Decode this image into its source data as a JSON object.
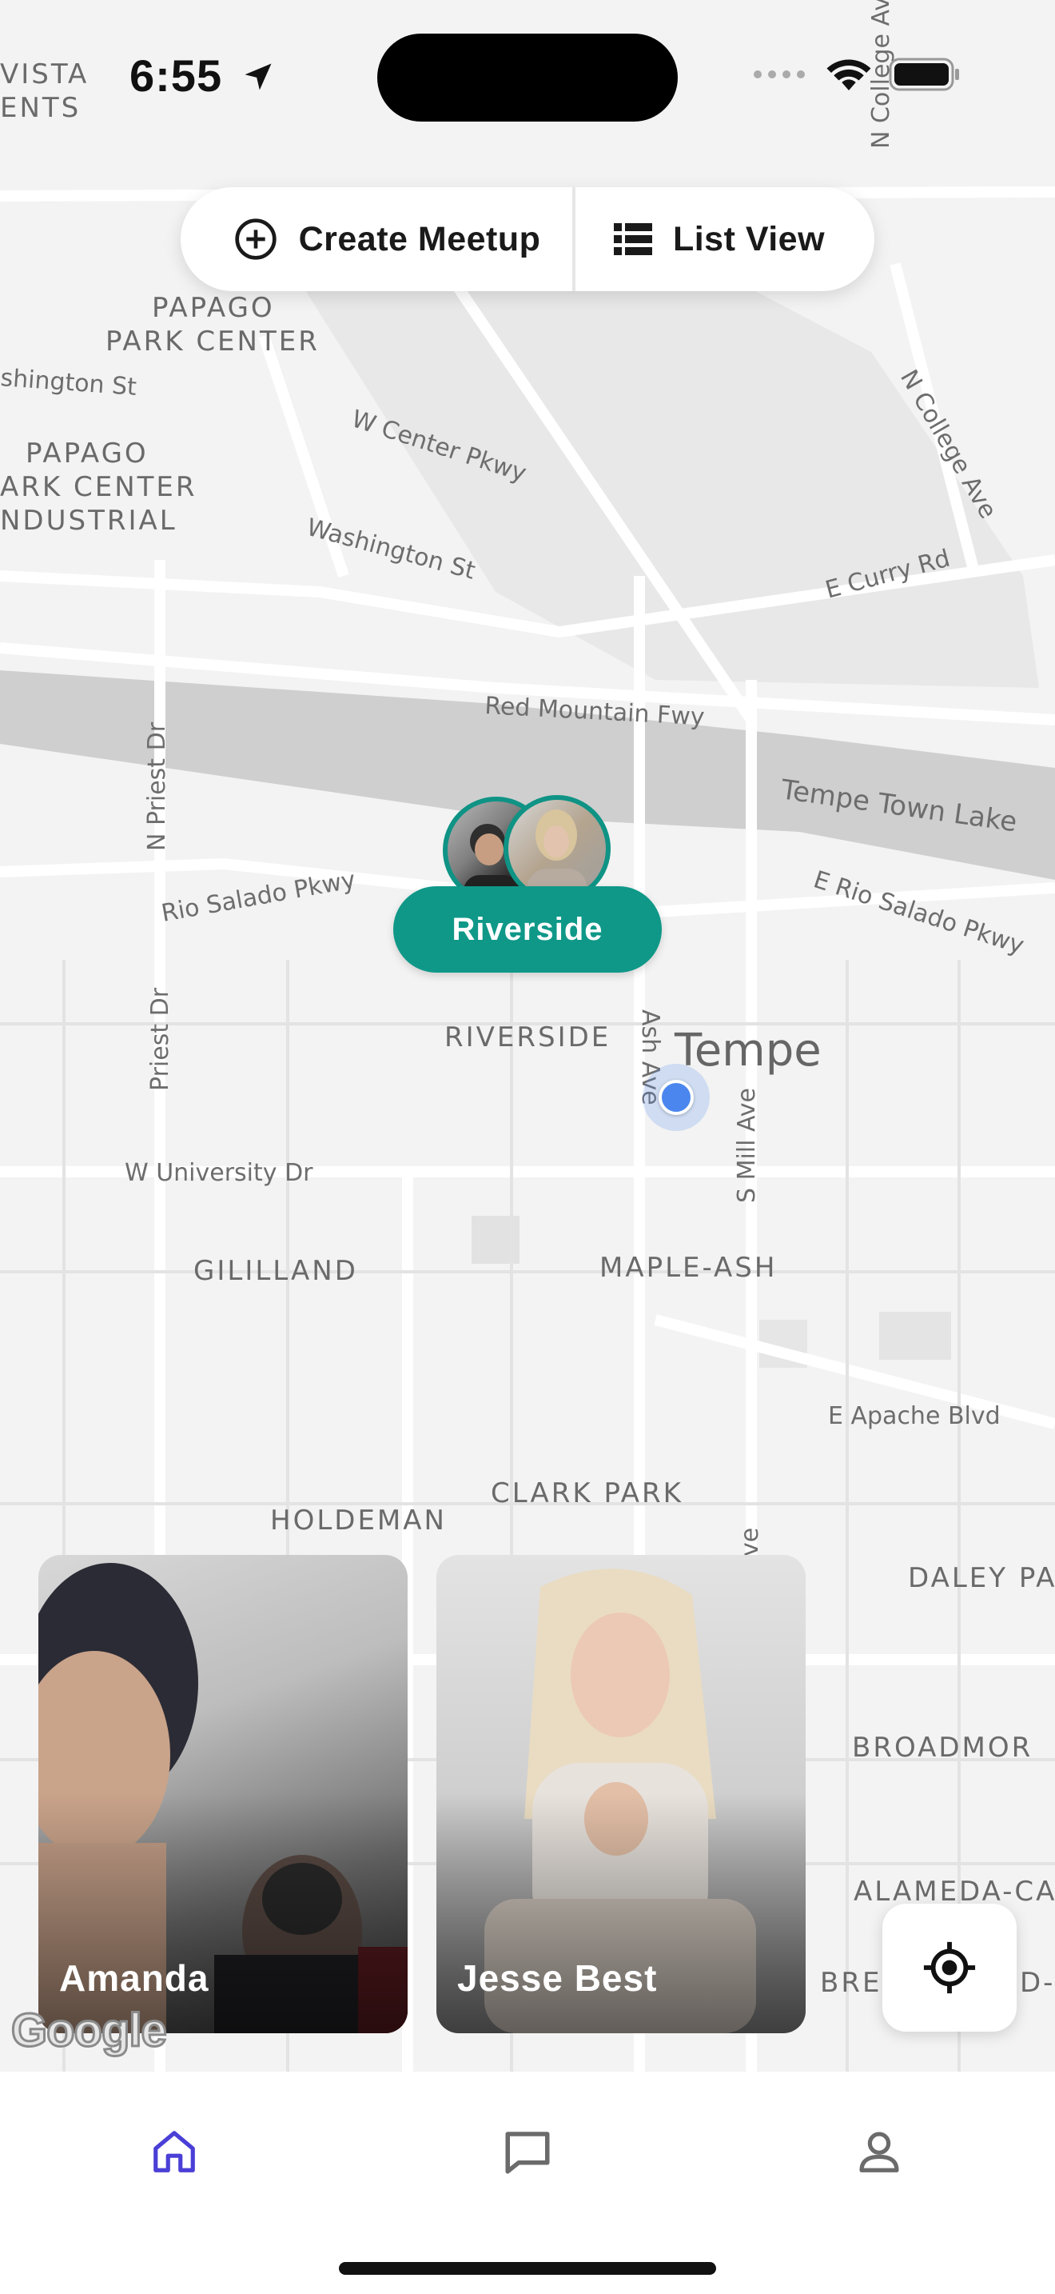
{
  "status_bar": {
    "time": "6:55"
  },
  "top_bar": {
    "create_meetup_label": "Create Meetup",
    "list_view_label": "List View"
  },
  "map": {
    "streets": {
      "washington_w": "shington St",
      "w_center_pkwy": "W Center Pkwy",
      "washington_st": "Washington St",
      "e_curry_rd": "E Curry Rd",
      "red_mountain_fwy": "Red Mountain Fwy",
      "tempe_town_lake": "Tempe Town Lake",
      "n_priest_dr": "N Priest Dr",
      "priest_dr": "Priest Dr",
      "rio_salado_pkwy": "Rio Salado Pkwy",
      "e_rio_salado_pkwy": "E Rio Salado Pkwy",
      "ash_ave": "Ash Ave",
      "s_mill_ave": "S Mill Ave",
      "w_university_dr": "W University Dr",
      "e_apache_blvd": "E Apache Blvd",
      "n_college_ave": "N College Ave",
      "n_college_ave_top": "N College Av",
      "ave_fragment": "ve"
    },
    "areas": {
      "vista_1": "VISTA",
      "vista_2": "ENTS",
      "papago_park_center_1": "PAPAGO",
      "papago_park_center_2": "PARK CENTER",
      "papago_industrial_1": "PAPAGO",
      "papago_industrial_2": "ARK CENTER",
      "papago_industrial_3": "NDUSTRIAL",
      "riverside": "RIVERSIDE",
      "gililland": "GILILLAND",
      "maple_ash": "MAPLE-ASH",
      "clark_park": "CLARK PARK",
      "holdeman": "HOLDEMAN",
      "daley_park": "DALEY PA",
      "broadmor": "BROADMOR",
      "alameda": "ALAMEDA-CA",
      "brep": "BRE",
      "brep2": "D-C"
    },
    "city_label": "Tempe",
    "google_logo": "Google"
  },
  "meetup_marker": {
    "label": "Riverside"
  },
  "cards": [
    {
      "name": "Amanda"
    },
    {
      "name": "Jesse Best"
    }
  ],
  "colors": {
    "accent": "#0f9888",
    "tab_active": "#4a3fd6",
    "tab_inactive": "#6b6b6b",
    "user_dot": "#4a86ee"
  },
  "icons": {
    "create_meetup": "plus-circle-icon",
    "list_view": "list-icon",
    "locate": "crosshair-icon",
    "tab_home": "home-icon",
    "tab_messages": "chat-icon",
    "tab_profile": "user-icon"
  }
}
